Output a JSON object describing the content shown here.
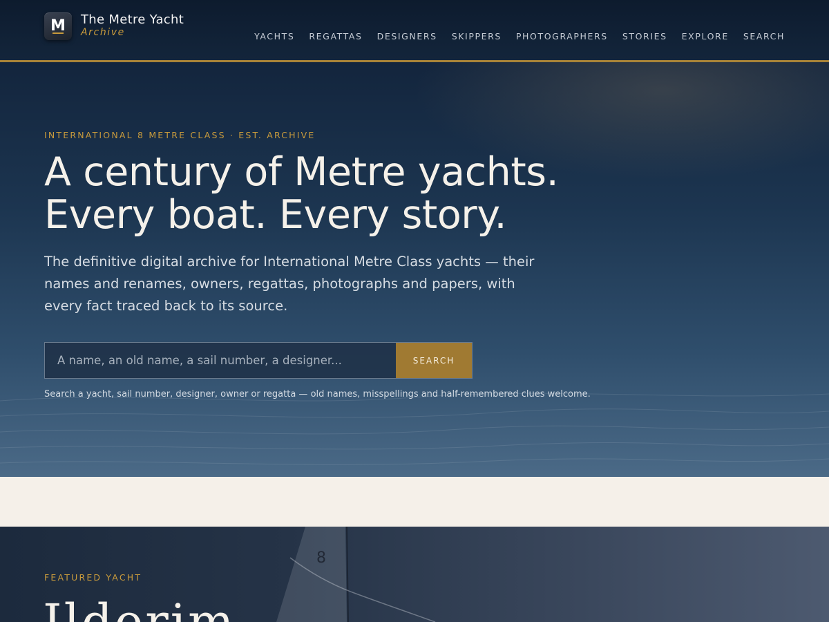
{
  "brand": {
    "mark": "M",
    "title": "The Metre Yacht",
    "subtitle": "Archive"
  },
  "nav": {
    "items": [
      "YACHTS",
      "REGATTAS",
      "DESIGNERS",
      "SKIPPERS",
      "PHOTOGRAPHERS",
      "STORIES",
      "EXPLORE",
      "SEARCH"
    ]
  },
  "hero": {
    "eyebrow": "INTERNATIONAL 8 METRE CLASS · EST. ARCHIVE",
    "headline_line1": "A century of Metre yachts.",
    "headline_line2": "Every boat. Every story.",
    "lead": "The definitive digital archive for International Metre Class yachts — their names and renames, owners, regattas, photographs and papers, with every fact traced back to its source.",
    "search_placeholder": "A name, an old name, a sail number, a designer...",
    "search_value": "",
    "search_button": "SEARCH",
    "hint": "Search a yacht, sail number, designer, owner or regatta — old names, misspellings and half-remembered clues welcome."
  },
  "featured": {
    "eyebrow": "FEATURED YACHT",
    "name": "Ilderim",
    "sail_number": "8"
  },
  "colors": {
    "accent": "#a98438",
    "navy": "#0d1b2e",
    "cream": "#f5f0e9"
  }
}
